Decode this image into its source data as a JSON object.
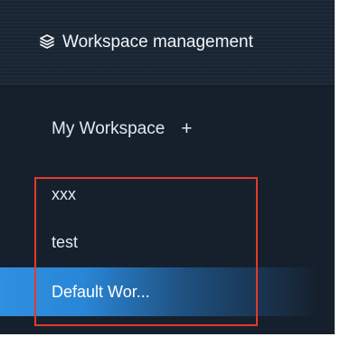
{
  "header": {
    "title": "Workspace management",
    "icon": "layers-icon"
  },
  "section": {
    "label": "My Workspace",
    "add_label": "+"
  },
  "workspaces": [
    {
      "label": "xxx",
      "active": false
    },
    {
      "label": "test",
      "active": false
    },
    {
      "label": "Default Wor...",
      "active": true
    }
  ],
  "colors": {
    "panel_background": "#16202d",
    "active_item": "#2f8fe0",
    "annotation_box": "#e5392b",
    "text": "#e3e8ee"
  }
}
